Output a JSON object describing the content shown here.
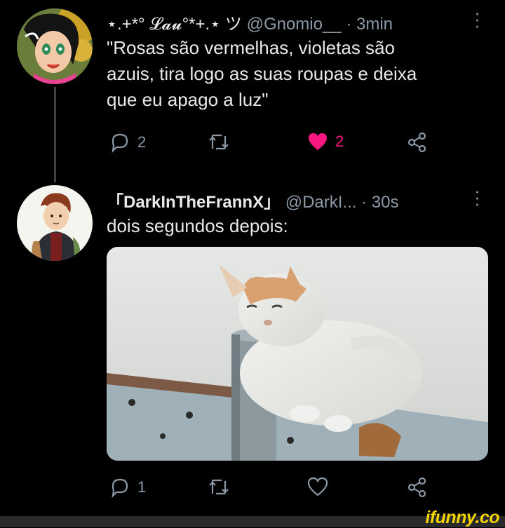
{
  "tweets": [
    {
      "display_name": "⋆.+*° 𝓛𝓪𝓾°*+.⋆ ツ",
      "handle": "@Gnomio__",
      "time": "· 3min",
      "text_lines": [
        "\"Rosas são vermelhas, violetas são",
        "azuis, tira logo as suas roupas e deixa",
        "que eu apago a luz\""
      ],
      "replies": "2",
      "retweets": "",
      "likes": "2",
      "liked": true
    },
    {
      "display_name": "「DarkInTheFrannX」",
      "handle": "@DarkI...",
      "time": "· 30s",
      "text_lines": [
        "dois segundos depois:"
      ],
      "replies": "1",
      "retweets": "",
      "likes": "",
      "liked": false
    }
  ],
  "watermark": "ifunny.co",
  "icons": {
    "reply": "reply-icon",
    "retweet": "retweet-icon",
    "like": "heart-icon",
    "share": "share-icon",
    "more": "more-vertical-icon"
  },
  "colors": {
    "background": "#000000",
    "text": "#e7e9ea",
    "muted": "#8b98a5",
    "like": "#f91880",
    "watermark": "#f4d400"
  }
}
